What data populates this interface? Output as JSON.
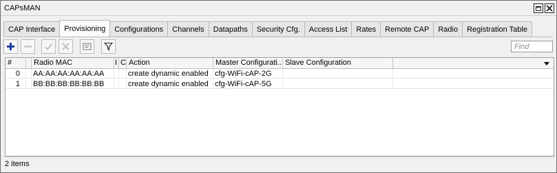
{
  "window": {
    "title": "CAPsMAN"
  },
  "tabs": [
    {
      "label": "CAP Interface"
    },
    {
      "label": "Provisioning",
      "active": true
    },
    {
      "label": "Configurations"
    },
    {
      "label": "Channels"
    },
    {
      "label": "Datapaths"
    },
    {
      "label": "Security Cfg."
    },
    {
      "label": "Access List"
    },
    {
      "label": "Rates"
    },
    {
      "label": "Remote CAP"
    },
    {
      "label": "Radio"
    },
    {
      "label": "Registration Table"
    }
  ],
  "toolbar": {
    "icons": [
      "add-icon",
      "remove-icon",
      "enable-icon",
      "disable-icon",
      "comment-icon",
      "filter-icon"
    ],
    "find_placeholder": "Find"
  },
  "table": {
    "columns": [
      "#",
      "",
      "Radio MAC",
      "I",
      "C",
      "Action",
      "Master Configurati...",
      "Slave Configuration"
    ],
    "rows": [
      {
        "num": "0",
        "mac": "AA:AA:AA:AA:AA:AA",
        "i": "",
        "c": "",
        "action": "create dynamic enabled",
        "master": "cfg-WiFi-cAP-2G",
        "slave": ""
      },
      {
        "num": "1",
        "mac": "BB:BB:BB:BB:BB:BB",
        "i": "",
        "c": "",
        "action": "create dynamic enabled",
        "master": "cfg-WiFi-cAP-5G",
        "slave": ""
      }
    ]
  },
  "status": {
    "text": "2 items"
  },
  "colors": {
    "add": "#1e3f9c",
    "window_bg": "#f0f0f0"
  }
}
